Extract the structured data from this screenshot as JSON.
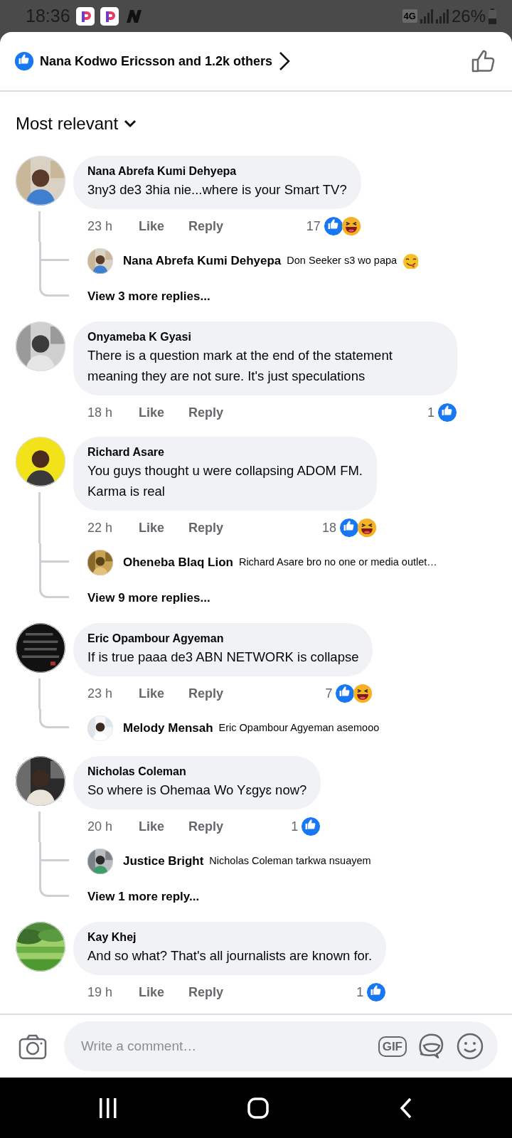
{
  "status_bar": {
    "time": "18:36",
    "network": "4G",
    "battery": "26%"
  },
  "header": {
    "likers": "Nana Kodwo Ericsson and 1.2k others"
  },
  "sort": {
    "label": "Most relevant"
  },
  "comments": [
    {
      "author": "Nana Abrefa Kumi Dehyepa",
      "text": "3ny3 de3 3hia nie...where is your Smart TV?",
      "time": "23 h",
      "like": "Like",
      "reply": "Reply",
      "reaction_count": "17",
      "reactions": [
        {
          "kind": "like"
        },
        {
          "kind": "haha"
        }
      ],
      "replies": [
        {
          "author": "Nana Abrefa Kumi Dehyepa",
          "text": "Don Seeker s3 wo papa",
          "icon": {
            "kind": "yum"
          }
        }
      ],
      "more_replies": "View 3 more replies..."
    },
    {
      "author": "Onyameba K Gyasi",
      "text": "There is a question mark at the end of the statement meaning they are not sure. It's just speculations",
      "time": "18 h",
      "like": "Like",
      "reply": "Reply",
      "reaction_count": "1",
      "reactions": [
        {
          "kind": "like"
        }
      ]
    },
    {
      "author": "Richard Asare",
      "text": "You guys thought u were collapsing ADOM FM.\nKarma is real",
      "time": "22 h",
      "like": "Like",
      "reply": "Reply",
      "reaction_count": "18",
      "reactions": [
        {
          "kind": "like"
        },
        {
          "kind": "haha"
        }
      ],
      "replies": [
        {
          "author": "Oheneba Blaq Lion",
          "text": "Richard Asare bro no one or media outlet…"
        }
      ],
      "more_replies": "View 9 more replies..."
    },
    {
      "author": "Eric Opambour Agyeman",
      "text": "If is true paaa de3 ABN NETWORK is collapse",
      "time": "23 h",
      "like": "Like",
      "reply": "Reply",
      "reaction_count": "7",
      "reactions": [
        {
          "kind": "like"
        },
        {
          "kind": "haha"
        }
      ],
      "replies": [
        {
          "author": "Melody Mensah",
          "text": "Eric Opambour Agyeman asemooo"
        }
      ]
    },
    {
      "author": "Nicholas Coleman",
      "text": "So where is Ohemaa Wo Yɛgyɛ now?",
      "time": "20 h",
      "like": "Like",
      "reply": "Reply",
      "reaction_count": "1",
      "reactions": [
        {
          "kind": "like"
        }
      ],
      "replies": [
        {
          "author": "Justice Bright",
          "text": "Nicholas Coleman tarkwa nsuayem"
        }
      ],
      "more_replies": "View 1 more reply..."
    },
    {
      "author": "Kay Khej",
      "text": "And so what? That's all journalists are known for.",
      "time": "19 h",
      "like": "Like",
      "reply": "Reply",
      "reaction_count": "1",
      "reactions": [
        {
          "kind": "like"
        }
      ]
    }
  ],
  "composer": {
    "placeholder": "Write a comment…",
    "gif": "GIF"
  }
}
